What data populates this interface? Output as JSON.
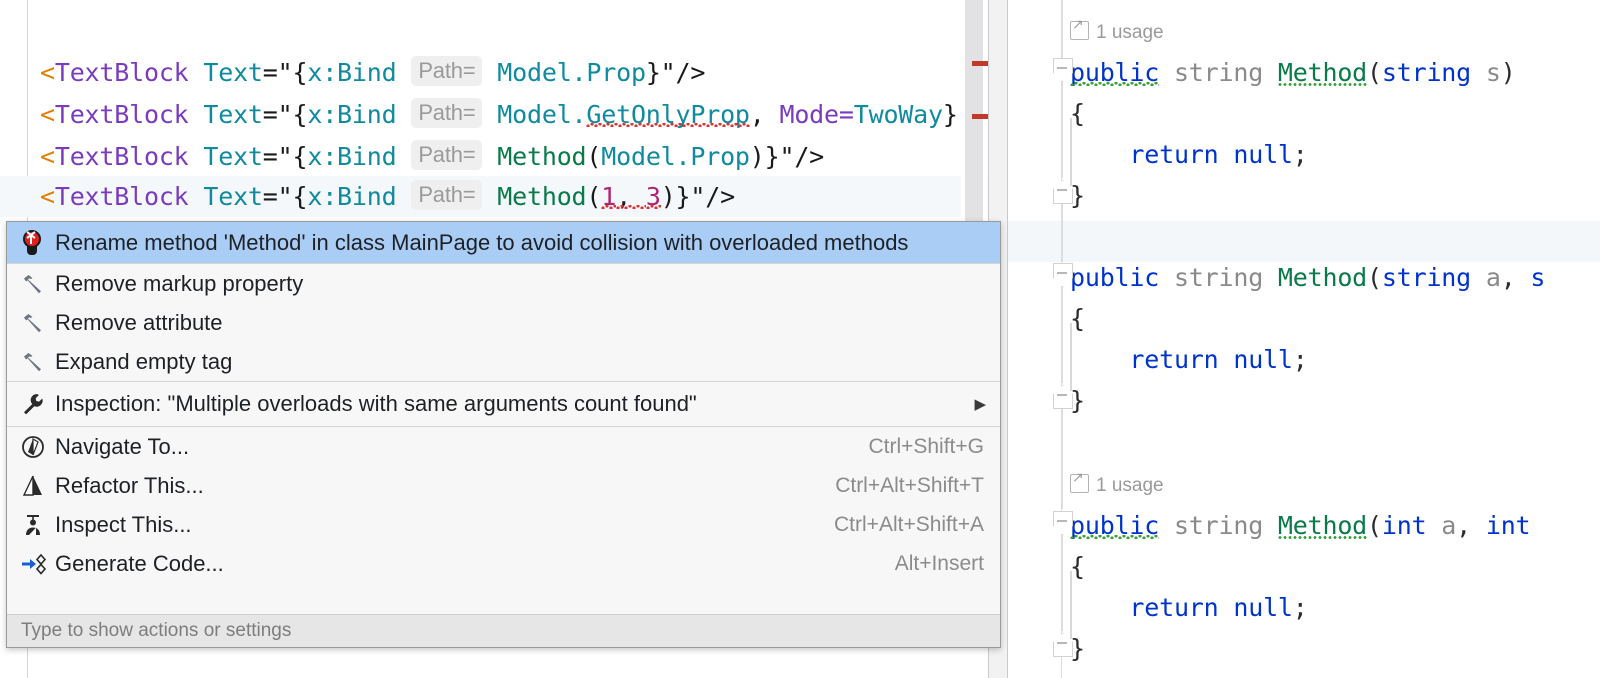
{
  "xaml_editor": {
    "name": "xaml-code-editor",
    "lines": [
      {
        "tag_open": "<TextBlock",
        "attr": " Text=",
        "quote": "\"",
        "brace_open": "{",
        "markup_ext": "x:Bind",
        "hint": "Path=",
        "value_prefix": "Model.",
        "value_main": "Prop",
        "value_suffix": "}\"/>",
        "current": false,
        "error": false
      },
      {
        "tag_open": "<TextBlock",
        "attr": " Text=",
        "quote": "\"",
        "brace_open": "{",
        "markup_ext": "x:Bind",
        "hint": "Path=",
        "value_prefix": "Model.",
        "value_main": "GetOnlyProp",
        "value_suffix": ", Mode=",
        "mode_value": "TwoWay",
        "value_tail": "}",
        "current": false,
        "error": true
      },
      {
        "tag_open": "<TextBlock",
        "attr": " Text=",
        "quote": "\"",
        "brace_open": "{",
        "markup_ext": "x:Bind",
        "hint": "Path=",
        "method": "Method",
        "args": "(Model.Prop)",
        "value_suffix": "}\"/>",
        "current": false,
        "error": false
      },
      {
        "tag_open": "<TextBlock",
        "attr": " Text=",
        "quote": "\"",
        "brace_open": "{",
        "markup_ext": "x:Bind",
        "hint": "Path=",
        "method": "Method",
        "arg_open": "(",
        "arg1": "1",
        "arg_sep": ", ",
        "arg2": "3",
        "arg_close": ")",
        "value_suffix": "}\"/>",
        "current": true,
        "error": true
      }
    ]
  },
  "cs_editor": {
    "name": "csharp-code-editor",
    "usage_hint": "1 usage",
    "methods": [
      {
        "usage": "1 usage",
        "signature_keyword": "public",
        "signature_type": "string",
        "signature_name": "Method",
        "signature_params": "(string s)",
        "open_brace": "{",
        "body": "    return null;",
        "close_brace": "}",
        "has_usage": true,
        "warn_keyword": true
      },
      {
        "usage": "",
        "signature_keyword": "public",
        "signature_type": "string",
        "signature_name": "Method",
        "signature_params": "(string a, s",
        "open_brace": "{",
        "body": "    return null;",
        "close_brace": "}",
        "has_usage": false,
        "warn_keyword": false
      },
      {
        "usage": "1 usage",
        "signature_keyword": "public",
        "signature_type": "string",
        "signature_name": "Method",
        "signature_params": "(int a, int",
        "open_brace": "{",
        "body": "    return null;",
        "close_brace": "}",
        "has_usage": true,
        "warn_keyword": true
      }
    ],
    "body_return_kw": "return",
    "body_null_kw": "null",
    "body_semi": ";"
  },
  "action_popup": {
    "name": "intention-actions-popup",
    "items": [
      {
        "label": "Rename method 'Method' in class MainPage to avoid collision with overloaded methods",
        "icon": "bulb-icon",
        "shortcut": "",
        "selected": true,
        "submenu": false
      },
      {
        "label": "Remove markup property",
        "icon": "hammer-icon",
        "shortcut": "",
        "selected": false,
        "submenu": false
      },
      {
        "label": "Remove attribute",
        "icon": "hammer-icon",
        "shortcut": "",
        "selected": false,
        "submenu": false
      },
      {
        "label": "Expand empty tag",
        "icon": "hammer-icon",
        "shortcut": "",
        "selected": false,
        "submenu": false
      },
      {
        "label": "Inspection: \"Multiple overloads with same arguments count found\"",
        "icon": "wrench-icon",
        "shortcut": "",
        "selected": false,
        "submenu": true
      },
      {
        "label": "Navigate To...",
        "icon": "navigate-icon",
        "shortcut": "Ctrl+Shift+G",
        "selected": false,
        "submenu": false
      },
      {
        "label": "Refactor This...",
        "icon": "refactor-icon",
        "shortcut": "Ctrl+Alt+Shift+T",
        "selected": false,
        "submenu": false
      },
      {
        "label": "Inspect This...",
        "icon": "inspect-icon",
        "shortcut": "Ctrl+Alt+Shift+A",
        "selected": false,
        "submenu": false
      },
      {
        "label": "Generate Code...",
        "icon": "generate-code-icon",
        "shortcut": "Alt+Insert",
        "selected": false,
        "submenu": false
      }
    ],
    "footer": "Type to show actions or settings"
  },
  "colors": {
    "selection_blue": "#aacdf5",
    "error_red": "#c0392b",
    "warning_green": "#3aa03a",
    "keyword_blue": "#0033cc",
    "method_green": "#0a7a4a",
    "attr_teal": "#0f8a9e",
    "tag_purple": "#7a3bbf",
    "number_magenta": "#b02672"
  }
}
